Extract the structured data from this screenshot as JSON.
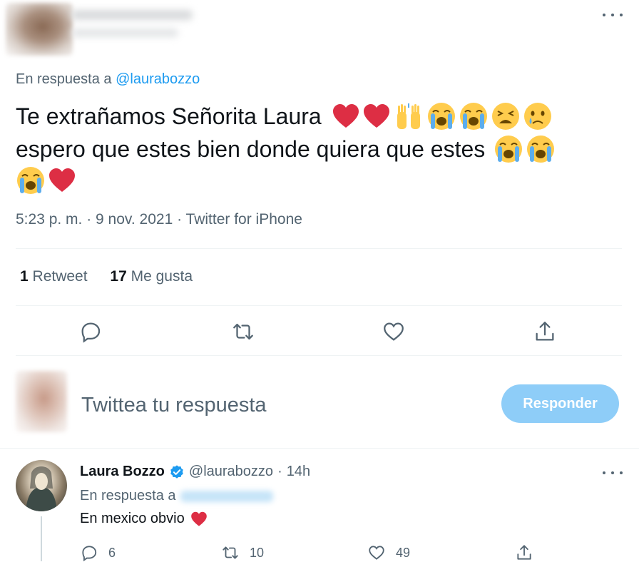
{
  "tweet": {
    "reply_prefix": "En respuesta a",
    "reply_handle": "@laurabozzo",
    "text_line1": "Te extrañamos Señorita Laura",
    "text_line2": "espero que estes bien donde quiera que estes",
    "meta": "5:23 p. m. · 9 nov. 2021 · Twitter for iPhone",
    "retweet_count": "1",
    "retweet_label": "Retweet",
    "like_count": "17",
    "like_label": "Me gusta",
    "icons": [
      "more-icon",
      "reply-icon",
      "retweet-icon",
      "like-icon",
      "share-icon"
    ]
  },
  "composer": {
    "placeholder": "Twittea tu respuesta",
    "button_label": "Responder"
  },
  "reply": {
    "name": "Laura Bozzo",
    "handle": "@laurabozzo",
    "time": "14h",
    "reply_prefix": "En respuesta a",
    "text": "En mexico obvio",
    "reply_count": "6",
    "retweet_count": "10",
    "like_count": "49"
  },
  "colors": {
    "accent": "#1d9bf0",
    "button_disabled": "#8ecdf8",
    "heart": "#dd2e44",
    "muted": "#536471"
  }
}
